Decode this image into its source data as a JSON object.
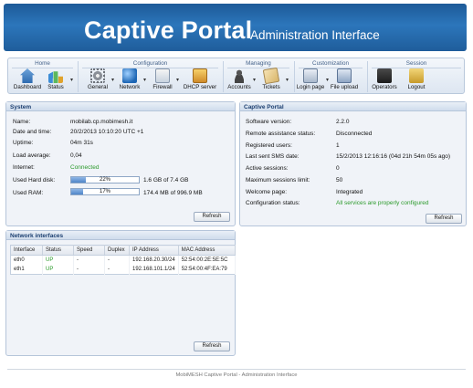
{
  "header": {
    "brand": "Captive Portal",
    "subtitle": "Administration Interface"
  },
  "toolbar": {
    "groups": [
      {
        "title": "Home",
        "items": [
          {
            "label": "Dashboard",
            "icon": "home-icon"
          },
          {
            "label": "Status",
            "icon": "chart-icon"
          }
        ]
      },
      {
        "title": "Configuration",
        "items": [
          {
            "label": "General",
            "icon": "gear-icon"
          },
          {
            "label": "Network",
            "icon": "globe-icon"
          },
          {
            "label": "Firewall",
            "icon": "firewall-icon"
          },
          {
            "label": "DHCP server",
            "icon": "dhcp-icon"
          }
        ]
      },
      {
        "title": "Managing",
        "items": [
          {
            "label": "Accounts",
            "icon": "users-icon"
          },
          {
            "label": "Tickets",
            "icon": "ticket-icon"
          }
        ]
      },
      {
        "title": "Customization",
        "items": [
          {
            "label": "Login page",
            "icon": "login-page-icon"
          },
          {
            "label": "File upload",
            "icon": "upload-icon"
          }
        ]
      },
      {
        "title": "Session",
        "items": [
          {
            "label": "Operators",
            "icon": "briefcase-icon"
          },
          {
            "label": "Logout",
            "icon": "lock-icon"
          }
        ]
      }
    ]
  },
  "system": {
    "title": "System",
    "rows": [
      {
        "label": "Name:",
        "value": "mobilab.cp.mobimesh.it"
      },
      {
        "label": "Date and time:",
        "value": "20/2/2013 10:10:20 UTC +1"
      },
      {
        "label": "Uptime:",
        "value": "04m 31s"
      },
      {
        "label": "Load average:",
        "value": "0,04"
      },
      {
        "label": "Internet:",
        "value": "Connected"
      }
    ],
    "disk": {
      "label": "Used Hard disk:",
      "percent_text": "22%",
      "percent": 22,
      "detail": "1.6 GB of 7.4 GB"
    },
    "ram": {
      "label": "Used RAM:",
      "percent_text": "17%",
      "percent": 17,
      "detail": "174.4 MB of 996.9 MB"
    },
    "refresh": "Refresh"
  },
  "captive": {
    "title": "Captive Portal",
    "rows": [
      {
        "label": "Software version:",
        "value": "2.2.0"
      },
      {
        "label": "Remote assistance status:",
        "value": "Disconnected"
      },
      {
        "label": "Registered users:",
        "value": "1"
      },
      {
        "label": "Last sent SMS date:",
        "value": "15/2/2013 12:16:16 (04d 21h 54m 05s ago)"
      },
      {
        "label": "Active sessions:",
        "value": "0"
      },
      {
        "label": "Maximum sessions limit:",
        "value": "50"
      },
      {
        "label": "Welcome page:",
        "value": "Integrated"
      },
      {
        "label": "Configuration status:",
        "value": "All services are properly configured"
      }
    ],
    "refresh": "Refresh"
  },
  "network": {
    "title": "Network interfaces",
    "columns": [
      "Interface",
      "Status",
      "Speed",
      "Duplex",
      "IP Address",
      "MAC Address"
    ],
    "rows": [
      [
        "eth0",
        "UP",
        "-",
        "-",
        "192.168.20.30/24",
        "52:54:00:2E:5E:5C"
      ],
      [
        "eth1",
        "UP",
        "-",
        "-",
        "192.168.101.1/24",
        "52:54:00:4F:EA:79"
      ]
    ],
    "refresh": "Refresh"
  },
  "footer": "MobiMESH Captive Portal - Administration Interface",
  "colors": {
    "header": "#2c76bb",
    "accent_green": "#2b9a2b",
    "panel_bg": "#f0f3f8"
  }
}
